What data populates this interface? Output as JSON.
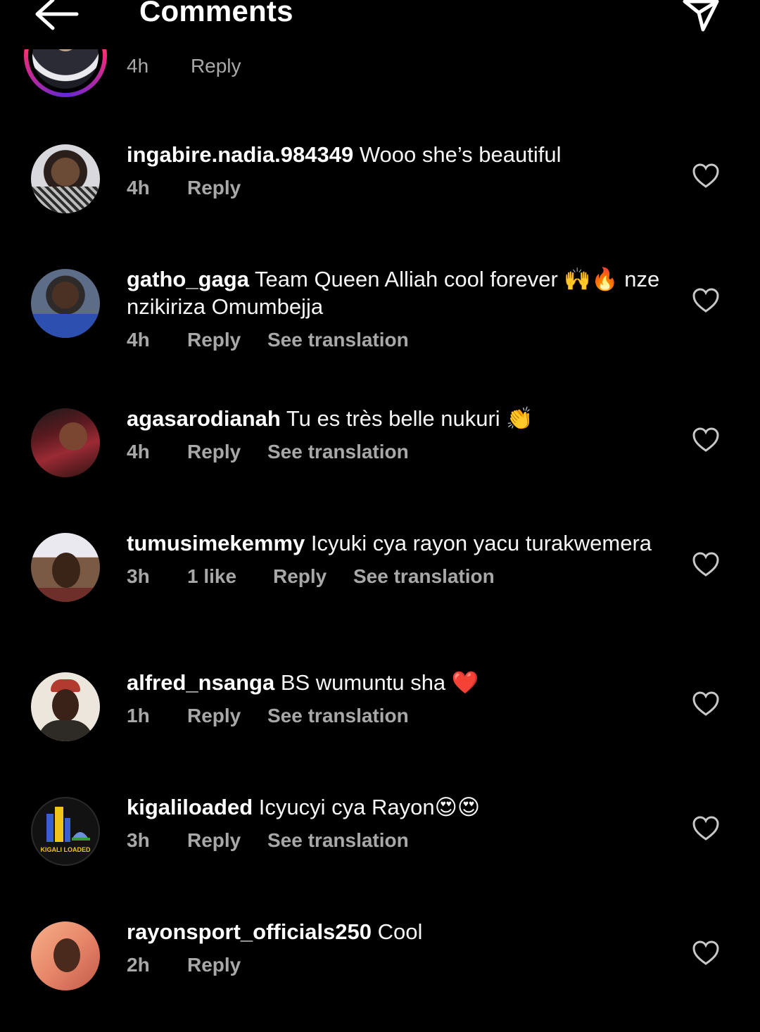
{
  "header": {
    "title": "Comments"
  },
  "partial_comment": {
    "time": "4h",
    "reply_label": "Reply"
  },
  "labels": {
    "reply": "Reply",
    "see_translation": "See translation"
  },
  "comments": [
    {
      "username": "ingabire.nadia.984349",
      "text": "Wooo she’s beautiful",
      "time": "4h",
      "likes": "",
      "translation": false
    },
    {
      "username": "gatho_gaga",
      "text": "Team Queen Alliah cool forever 🙌🔥 nze nzikiriza Omumbejja",
      "time": "4h",
      "likes": "",
      "translation": true
    },
    {
      "username": "agasarodianah",
      "text": "Tu es très belle nukuri 👏",
      "time": "4h",
      "likes": "",
      "translation": true
    },
    {
      "username": "tumusimekemmy",
      "text": "Icyuki cya rayon yacu turakwemera",
      "time": "3h",
      "likes": "1 like",
      "translation": true
    },
    {
      "username": "alfred_nsanga",
      "text": "BS wumuntu sha ❤️",
      "time": "1h",
      "likes": "",
      "translation": true
    },
    {
      "username": "kigaliloaded",
      "text": "Icyucyi cya Rayon😍😍",
      "time": "3h",
      "likes": "",
      "translation": true
    },
    {
      "username": "rayonsport_officials250",
      "text": "Cool",
      "time": "2h",
      "likes": "",
      "translation": false
    }
  ],
  "avatar_logo_text": "KIGALI LOADED",
  "icons": {
    "back": "arrow-left-icon",
    "send": "paper-plane-icon",
    "like": "heart-outline-icon"
  },
  "colors": {
    "background": "#000000",
    "text": "#f5f5f5",
    "meta": "#a8a8a8"
  }
}
